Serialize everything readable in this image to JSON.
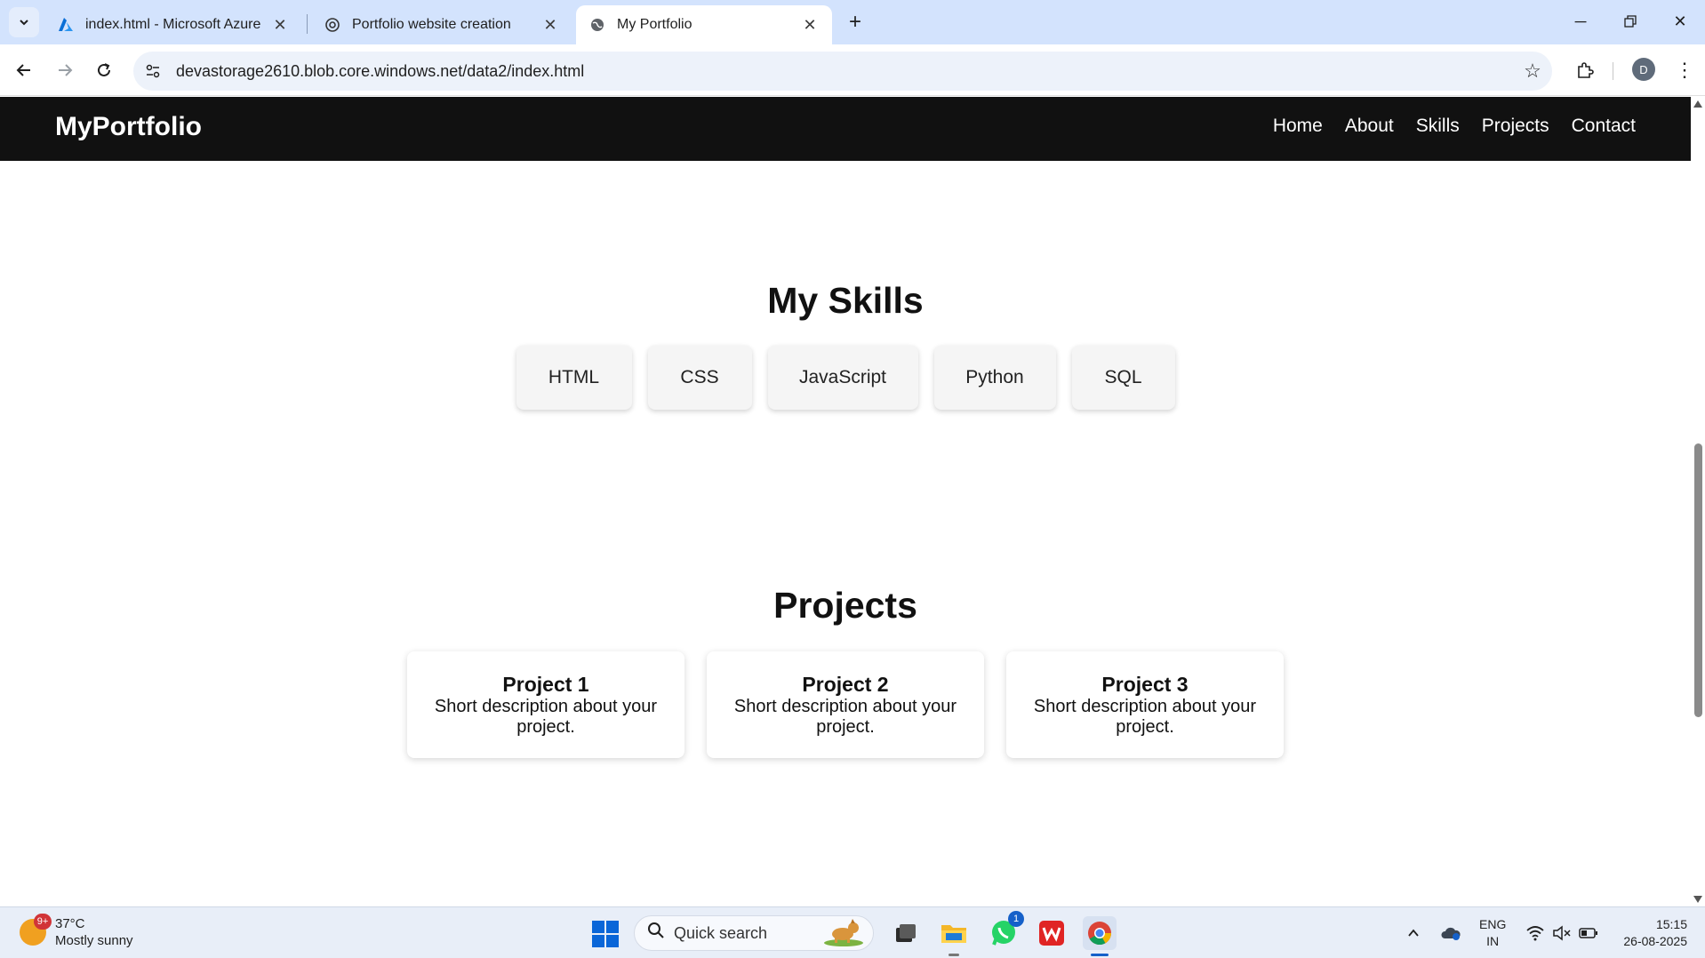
{
  "browser": {
    "tabs": [
      {
        "label": "index.html - Microsoft Azure",
        "icon": "azure-icon",
        "active": false
      },
      {
        "label": "Portfolio website creation",
        "icon": "openai-icon",
        "active": false
      },
      {
        "label": "My Portfolio",
        "icon": "globe-icon",
        "active": true
      }
    ],
    "url": "devastorage2610.blob.core.windows.net/data2/index.html",
    "profile_initial": "D"
  },
  "site": {
    "logo": "MyPortfolio",
    "nav": [
      "Home",
      "About",
      "Skills",
      "Projects",
      "Contact"
    ]
  },
  "skills": {
    "title": "My Skills",
    "items": [
      "HTML",
      "CSS",
      "JavaScript",
      "Python",
      "SQL"
    ]
  },
  "projects": {
    "title": "Projects",
    "items": [
      {
        "title": "Project 1",
        "description": "Short description about your project."
      },
      {
        "title": "Project 2",
        "description": "Short description about your project."
      },
      {
        "title": "Project 3",
        "description": "Short description about your project."
      }
    ]
  },
  "taskbar": {
    "weather_temp": "37°C",
    "weather_desc": "Mostly sunny",
    "weather_badge": "9+",
    "search_placeholder": "Quick search",
    "whatsapp_badge": "1",
    "lang_top": "ENG",
    "lang_bottom": "IN",
    "time": "15:15",
    "date": "26-08-2025"
  },
  "colors": {
    "header_bg": "#111111",
    "tabbar_bg": "#d3e3fd",
    "omnibox_bg": "#edf2fa",
    "taskbar_bg": "#e8eef8"
  }
}
